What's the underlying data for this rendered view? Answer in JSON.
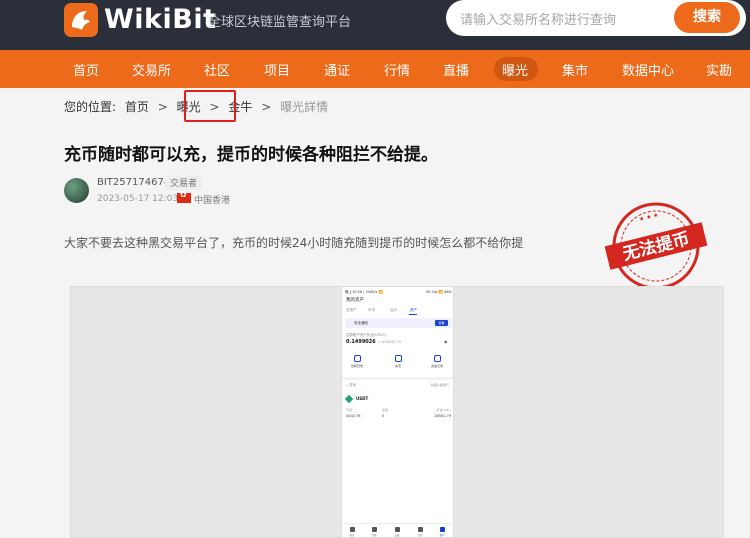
{
  "header": {
    "logo_text": "WikiBit",
    "slogan": "全球区块链监管查询平台",
    "search_placeholder": "请输入交易所名称进行查询",
    "search_button": "搜索"
  },
  "nav": {
    "items": [
      "首页",
      "交易所",
      "社区",
      "项目",
      "通证",
      "行情",
      "直播",
      "曝光",
      "集市",
      "数据中心",
      "实勘"
    ],
    "active_index": 7
  },
  "breadcrumb": {
    "prefix": "您的位置:",
    "items": [
      "首页",
      "曝光",
      "金牛",
      "曝光詳情"
    ],
    "highlighted_index": 2,
    "separator": ">"
  },
  "article": {
    "title": "充币随时都可以充，提币的时候各种阻拦不给提。",
    "author": "BIT2571746745",
    "role": "交易者",
    "date": "2023-05-17 12:03",
    "region": "中国香港",
    "body": "大家不要去这种黑交易平台了，充币的时候24小时随充随到提币的时候怎么都不给你提",
    "stamp_text": "无法提币",
    "colors": {
      "accent": "#ee6a1b",
      "stamp": "#d3271f",
      "highlight_box": "#e0201a"
    }
  },
  "screenshot": {
    "status_left": "晚上10:56 | 340K/s 📶",
    "status_right": "5G Cat 📶 66%",
    "title": "我的资产",
    "tabs": [
      "总资产",
      "币币",
      "合约",
      "资产"
    ],
    "active_tab": 3,
    "banner_text": "安全通知",
    "banner_button": "查看",
    "balance_label": "估算账户资产折合(USDT)",
    "balance_value": "0.1499026",
    "balance_sub": "≈ ¥38000.70",
    "actions": [
      "划转历史",
      "充币",
      "资金记录"
    ],
    "search_label": "搜索",
    "filter_label": "隐藏小额资产",
    "coin": "USDT",
    "columns": [
      "可用",
      "冻结",
      "折合(CNY)"
    ],
    "values": [
      "4002.76",
      "0",
      "28581.79"
    ],
    "bottom_nav": [
      "首页",
      "行情",
      "交易",
      "合约",
      "资产"
    ],
    "bottom_active": 4
  }
}
